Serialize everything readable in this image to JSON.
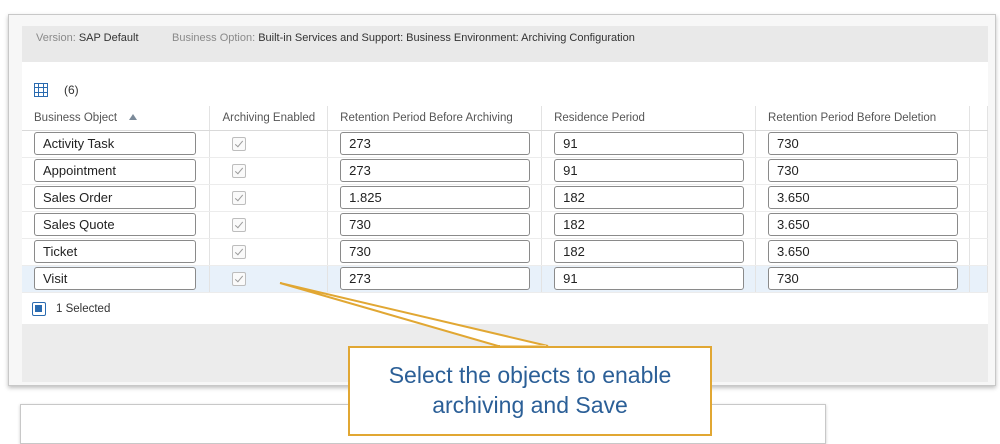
{
  "header": {
    "version_label": "Version:",
    "version_value": "SAP Default",
    "option_label": "Business Option:",
    "option_value": "Built-in Services and Support: Business Environment: Archiving Configuration"
  },
  "toolbar": {
    "count": "(6)",
    "icon": "grid-icon"
  },
  "table": {
    "columns": [
      "Business Object",
      "Archiving Enabled",
      "Retention Period Before Archiving",
      "Residence Period",
      "Retention Period Before Deletion"
    ],
    "rows": [
      {
        "object": "Activity Task",
        "enabled": true,
        "retention_archiving": "273",
        "residence": "91",
        "retention_deletion": "730"
      },
      {
        "object": "Appointment",
        "enabled": true,
        "retention_archiving": "273",
        "residence": "91",
        "retention_deletion": "730"
      },
      {
        "object": "Sales Order",
        "enabled": true,
        "retention_archiving": "1.825",
        "residence": "182",
        "retention_deletion": "3.650"
      },
      {
        "object": "Sales Quote",
        "enabled": true,
        "retention_archiving": "730",
        "residence": "182",
        "retention_deletion": "3.650"
      },
      {
        "object": "Ticket",
        "enabled": true,
        "retention_archiving": "730",
        "residence": "182",
        "retention_deletion": "3.650"
      },
      {
        "object": "Visit",
        "enabled": true,
        "retention_archiving": "273",
        "residence": "91",
        "retention_deletion": "730"
      }
    ]
  },
  "selection": {
    "label": "1 Selected"
  },
  "callout": {
    "line1": "Select the objects to enable",
    "line2": "archiving and Save"
  },
  "colors": {
    "accent": "#2a6bb0",
    "callout_border": "#e1a733",
    "callout_text": "#2b5f97"
  }
}
